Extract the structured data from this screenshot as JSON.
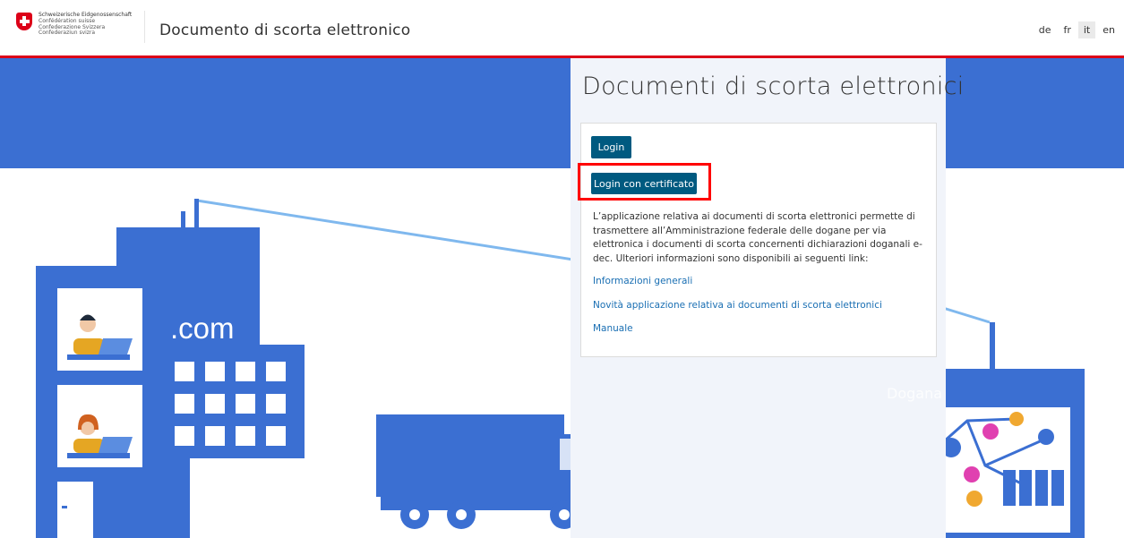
{
  "header": {
    "logo_lines": [
      "Schweizerische Eidgenossenschaft",
      "Confédération suisse",
      "Confederazione Svizzera",
      "Confederaziun svizra"
    ],
    "app_title": "Documento di scorta elettronico",
    "languages": [
      {
        "code": "de",
        "active": false
      },
      {
        "code": "fr",
        "active": false
      },
      {
        "code": "it",
        "active": true
      },
      {
        "code": "en",
        "active": false
      }
    ]
  },
  "panel": {
    "title": "Documenti di scorta elettronici",
    "login_label": "Login",
    "cert_login_label": "Login con certificato",
    "description": "L’applicazione relativa ai documenti di scorta elettronici permette di trasmettere all’Amministrazione federale delle dogane per via elettronica i documenti di scorta concernenti dichiarazioni doganali e-dec. Ulteriori informazioni sono disponibili ai seguenti link:",
    "links": [
      "Informazioni generali",
      "Novità applicazione relativa ai documenti di scorta elettronici",
      "Manuale"
    ]
  },
  "illustration": {
    "building_label": ".com",
    "customs_label": "Dogana"
  },
  "colors": {
    "swiss_red": "#dc0018",
    "illustration_blue": "#3b6fd2",
    "button_blue": "#005a80",
    "link_blue": "#1a6fb3",
    "highlight_red": "#ff0000"
  }
}
